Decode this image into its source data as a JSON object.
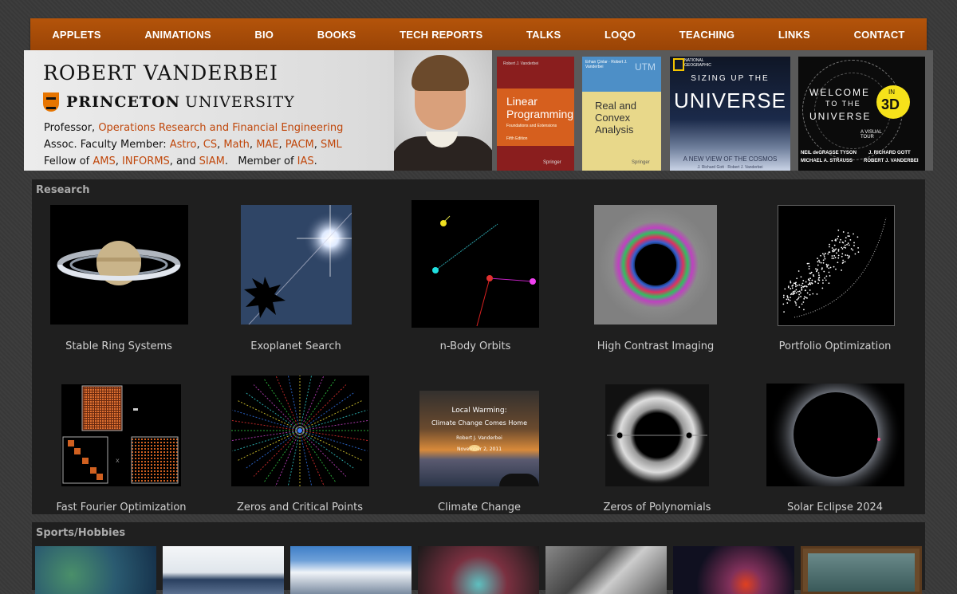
{
  "nav": [
    "APPLETS",
    "ANIMATIONS",
    "BIO",
    "BOOKS",
    "TECH REPORTS",
    "TALKS",
    "LOQO",
    "TEACHING",
    "LINKS",
    "CONTACT"
  ],
  "bio": {
    "name": "ROBERT VANDERBEI",
    "university_bold": "PRINCETON",
    "university_rest": "UNIVERSITY",
    "line1_prefix": "Professor, ",
    "line1_link": "Operations Research and Financial Engineering",
    "line2_prefix": "Assoc. Faculty Member: ",
    "line2_links": [
      "Astro",
      "CS",
      "Math",
      "MAE",
      "PACM",
      "SML"
    ],
    "line3_prefix": "Fellow of ",
    "line3_links": [
      "AMS",
      "INFORMS",
      "SIAM"
    ],
    "line3_and": ", and ",
    "line3_member": ".   Member of ",
    "line3_member_link": "IAS",
    "line3_end": "."
  },
  "books": {
    "lp": {
      "title": "Linear Programming",
      "sub": "Foundations and Extensions",
      "ed": "Fifth Edition",
      "author": "Robert J. Vanderbei",
      "pub": "Springer"
    },
    "cx": {
      "series": "UTM",
      "title": "Real and Convex Analysis",
      "authors": "Erhan Çinlar · Robert J. Vanderbei",
      "pub": "Springer"
    },
    "uv": {
      "publisher": "NATIONAL GEOGRAPHIC",
      "top": "SIZING UP THE",
      "title": "UNIVERSE",
      "sub": "A NEW VIEW OF THE COSMOS",
      "authors": "J. Richard Gott · Robert J. Vanderbei"
    },
    "w3": {
      "line1": "WELCOME",
      "line2": "TO THE",
      "line3": "UNIVERSE",
      "badge_in": "IN",
      "badge_3d": "3D",
      "sub": "A VISUAL TOUR",
      "a1": "NEIL deGRASSE TYSON",
      "a2": "MICHAEL A. STRAUSS",
      "a3": "J. RICHARD GOTT",
      "a4": "ROBERT J. VANDERBEI"
    }
  },
  "research": {
    "title": "Research",
    "items": [
      "Stable Ring Systems",
      "Exoplanet Search",
      "n-Body Orbits",
      "High Contrast Imaging",
      "Portfolio Optimization",
      "Fast Fourier Optimization",
      "Zeros and Critical Points",
      "Climate Change",
      "Zeros of Polynomials",
      "Solar Eclipse 2024"
    ],
    "climate_title": "Local Warming:",
    "climate_sub": "Climate Change Comes Home",
    "climate_author": "Robert J. Vanderbei",
    "climate_date": "November 2, 2011"
  },
  "sports": {
    "title": "Sports/Hobbies"
  }
}
